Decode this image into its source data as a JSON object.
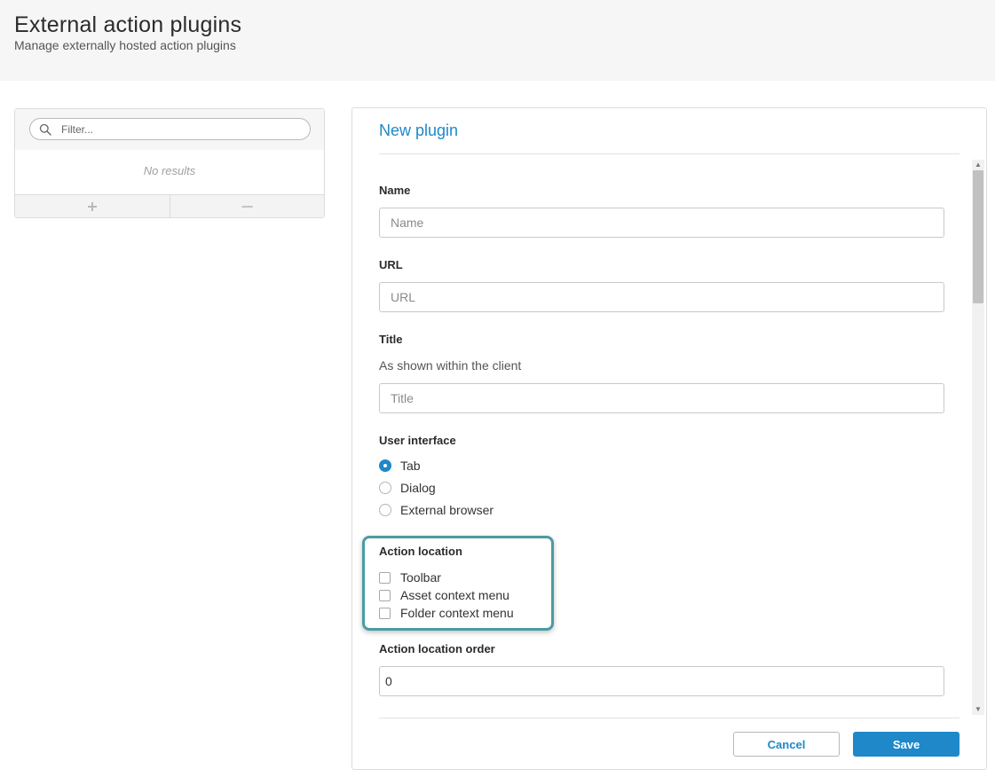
{
  "header": {
    "title": "External action plugins",
    "subtitle": "Manage externally hosted action plugins"
  },
  "list": {
    "filter_placeholder": "Filter...",
    "empty_text": "No results",
    "add_icon": "plus-icon",
    "remove_icon": "minus-icon"
  },
  "form": {
    "title": "New plugin",
    "name": {
      "label": "Name",
      "placeholder": "Name",
      "value": ""
    },
    "url": {
      "label": "URL",
      "placeholder": "URL",
      "value": ""
    },
    "title_field": {
      "label": "Title",
      "hint": "As shown within the client",
      "placeholder": "Title",
      "value": ""
    },
    "user_interface": {
      "label": "User interface",
      "options": [
        {
          "label": "Tab",
          "checked": true
        },
        {
          "label": "Dialog",
          "checked": false
        },
        {
          "label": "External browser",
          "checked": false
        }
      ]
    },
    "action_location": {
      "label": "Action location",
      "options": [
        {
          "label": "Toolbar",
          "checked": false
        },
        {
          "label": "Asset context menu",
          "checked": false
        },
        {
          "label": "Folder context menu",
          "checked": false
        }
      ]
    },
    "action_location_order": {
      "label": "Action location order",
      "value": "0"
    },
    "cancel_label": "Cancel",
    "save_label": "Save"
  },
  "colors": {
    "accent": "#1e88c8",
    "highlight": "#4a9ca2"
  }
}
